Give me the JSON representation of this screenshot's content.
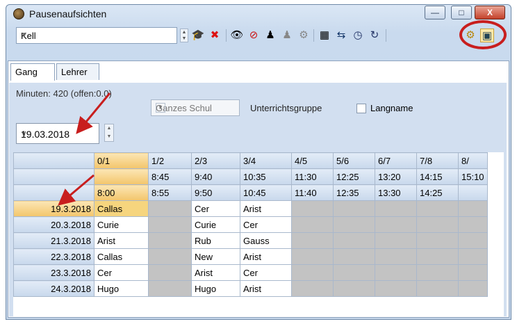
{
  "window": {
    "title": "Pausenaufsichten",
    "minimize": "—",
    "maximize": "□",
    "close": "X"
  },
  "toolbar": {
    "combo_value": "Kell",
    "icons": [
      "up-down-spinner",
      "graduation-cap-icon",
      "delete-icon",
      "eye-icon",
      "eye-off-icon",
      "people-icon",
      "people-gray-icon",
      "tool-icon",
      "calculator-icon",
      "export-icon",
      "clock-icon",
      "refresh-icon",
      "gear-icon",
      "window-settings-icon"
    ]
  },
  "tabs": [
    "Gang",
    "Lehrer"
  ],
  "panel": {
    "minuten": "Minuten: 420 (offen:0.0)",
    "scope": "Ganzes Schul",
    "unterrichtsgruppe": "Unterrichtsgruppe",
    "langname": "Langname",
    "date": "19.03.2018"
  },
  "grid": {
    "periods": [
      "0/1",
      "1/2",
      "2/3",
      "3/4",
      "4/5",
      "5/6",
      "6/7",
      "7/8",
      "8/"
    ],
    "start_times": [
      "",
      "8:45",
      "9:40",
      "10:35",
      "11:30",
      "12:25",
      "13:20",
      "14:15",
      "15:10"
    ],
    "end_times": [
      "8:00",
      "8:55",
      "9:50",
      "10:45",
      "11:40",
      "12:35",
      "13:30",
      "14:25",
      ""
    ],
    "rows": [
      {
        "date": "19.3.2018",
        "cells": [
          "Callas",
          "",
          "Cer",
          "Arist",
          "",
          "",
          "",
          "",
          ""
        ]
      },
      {
        "date": "20.3.2018",
        "cells": [
          "Curie",
          "",
          "Curie",
          "Cer",
          "",
          "",
          "",
          "",
          ""
        ]
      },
      {
        "date": "21.3.2018",
        "cells": [
          "Arist",
          "",
          "Rub",
          "Gauss",
          "",
          "",
          "",
          "",
          ""
        ]
      },
      {
        "date": "22.3.2018",
        "cells": [
          "Callas",
          "",
          "New",
          "Arist",
          "",
          "",
          "",
          "",
          ""
        ]
      },
      {
        "date": "23.3.2018",
        "cells": [
          "Cer",
          "",
          "Arist",
          "Cer",
          "",
          "",
          "",
          "",
          ""
        ]
      },
      {
        "date": "24.3.2018",
        "cells": [
          "Hugo",
          "",
          "Hugo",
          "Arist",
          "",
          "",
          "",
          "",
          ""
        ]
      }
    ]
  },
  "colors": {
    "accent_red": "#c81e1e",
    "selected": "#f3c56b",
    "gray_cell": "#c3c3c3"
  }
}
